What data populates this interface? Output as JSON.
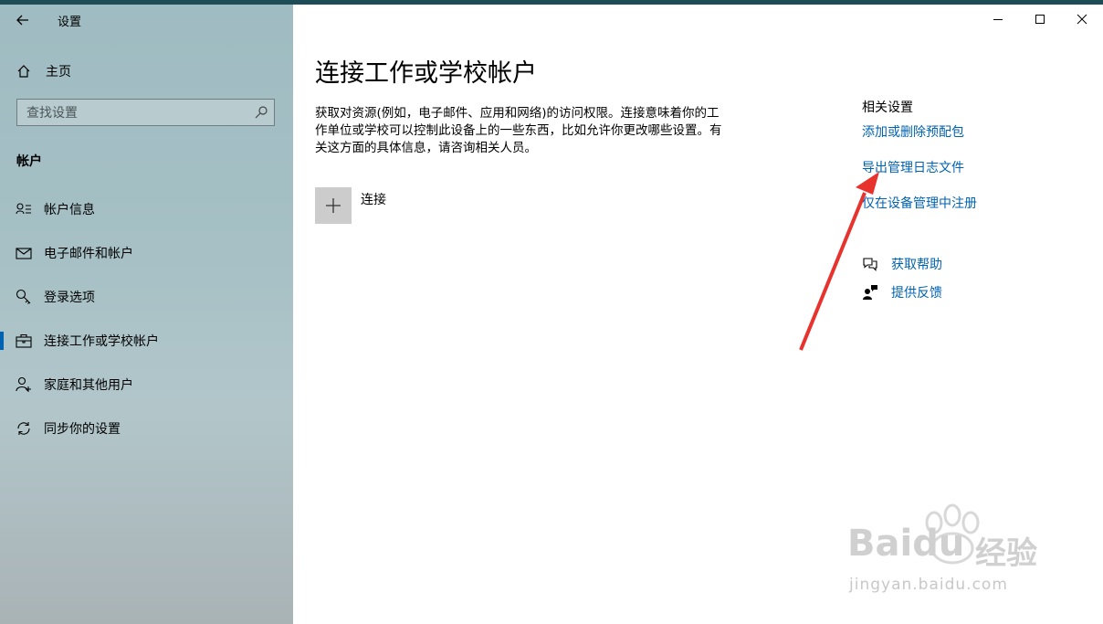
{
  "window": {
    "title": "设置",
    "controls": {
      "minimize": "minimize-icon",
      "maximize": "maximize-icon",
      "close": "close-icon"
    }
  },
  "sidebar": {
    "home_label": "主页",
    "search_placeholder": "查找设置",
    "section_title": "帐户",
    "items": [
      {
        "label": "帐户信息",
        "icon": "account-info-icon",
        "active": false
      },
      {
        "label": "电子邮件和帐户",
        "icon": "mail-icon",
        "active": false
      },
      {
        "label": "登录选项",
        "icon": "key-icon",
        "active": false
      },
      {
        "label": "连接工作或学校帐户",
        "icon": "briefcase-icon",
        "active": true
      },
      {
        "label": "家庭和其他用户",
        "icon": "add-person-icon",
        "active": false
      },
      {
        "label": "同步你的设置",
        "icon": "sync-icon",
        "active": false
      }
    ]
  },
  "main": {
    "title": "连接工作或学校帐户",
    "description": "获取对资源(例如，电子邮件、应用和网络)的访问权限。连接意味着你的工作单位或学校可以控制此设备上的一些东西，比如允许你更改哪些设置。有关这方面的具体信息，请咨询相关人员。",
    "connect_label": "连接"
  },
  "related": {
    "title": "相关设置",
    "links": [
      "添加或删除预配包",
      "导出管理日志文件",
      "仅在设备管理中注册"
    ],
    "help_label": "获取帮助",
    "feedback_label": "提供反馈"
  },
  "watermark": {
    "brand": "Baidu",
    "brand_cn": "经验",
    "domain": "jingyan.baidu.com"
  },
  "colors": {
    "accent": "#0063b1",
    "annotation_arrow": "#e8322d"
  }
}
